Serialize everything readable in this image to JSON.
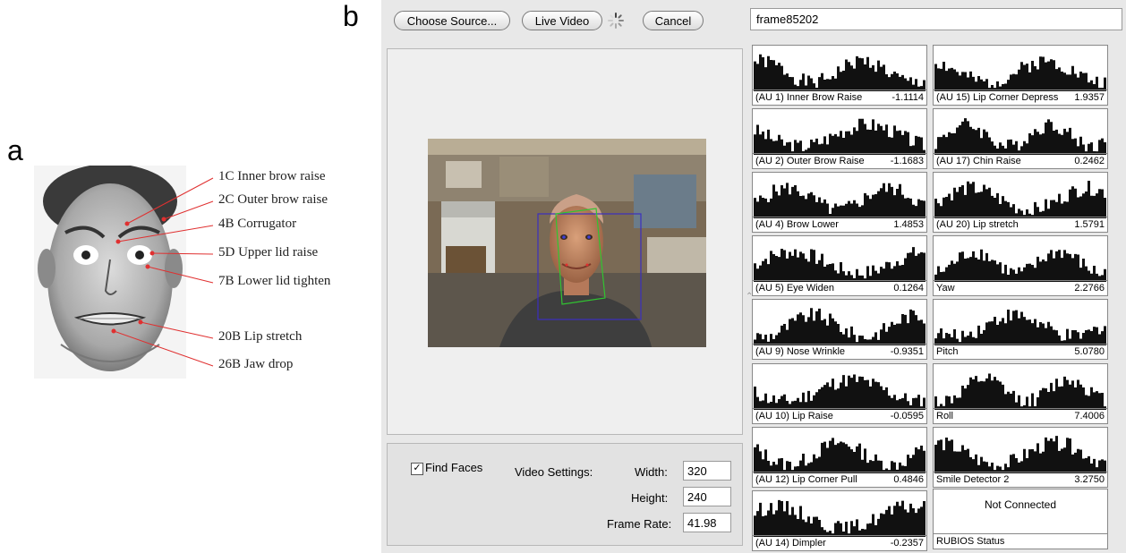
{
  "panel_a": {
    "letter": "a",
    "captions": [
      "1C Inner brow raise",
      "2C Outer brow raise",
      "4B Corrugator",
      "5D Upper lid raise",
      "7B Lower lid tighten",
      "20B Lip stretch",
      "26B Jaw drop"
    ]
  },
  "panel_b": {
    "letter": "b"
  },
  "toolbar": {
    "choose_source": "Choose Source...",
    "live_video": "Live Video",
    "cancel": "Cancel",
    "frame_name": "frame85202"
  },
  "settings": {
    "find_faces_label": "Find Faces",
    "find_faces_checked": true,
    "video_settings_label": "Video Settings:",
    "width_label": "Width:",
    "width_value": "320",
    "height_label": "Height:",
    "height_value": "240",
    "frame_rate_label": "Frame Rate:",
    "frame_rate_value": "41.98"
  },
  "au_tiles": [
    {
      "name": "(AU 1) Inner Brow Raise",
      "value": "-1.1114"
    },
    {
      "name": "(AU 15) Lip Corner Depress",
      "value": "1.9357"
    },
    {
      "name": "(AU 2) Outer Brow Raise",
      "value": "-1.1683"
    },
    {
      "name": "(AU 17) Chin Raise",
      "value": "0.2462"
    },
    {
      "name": "(AU 4) Brow Lower",
      "value": "1.4853"
    },
    {
      "name": "(AU 20) Lip stretch",
      "value": "1.5791"
    },
    {
      "name": "(AU 5) Eye Widen",
      "value": "0.1264"
    },
    {
      "name": "Yaw",
      "value": "2.2766"
    },
    {
      "name": "(AU 9) Nose Wrinkle",
      "value": "-0.9351"
    },
    {
      "name": "Pitch",
      "value": "5.0780"
    },
    {
      "name": "(AU 10) Lip Raise",
      "value": "-0.0595"
    },
    {
      "name": "Roll",
      "value": "7.4006"
    },
    {
      "name": "(AU 12) Lip Corner Pull",
      "value": "0.4846"
    },
    {
      "name": "Smile Detector 2",
      "value": "3.2750"
    },
    {
      "name": "(AU 14) Dimpler",
      "value": "-0.2357"
    }
  ],
  "status_tile": {
    "status_text": "Not Connected",
    "label": "RUBIOS Status"
  }
}
